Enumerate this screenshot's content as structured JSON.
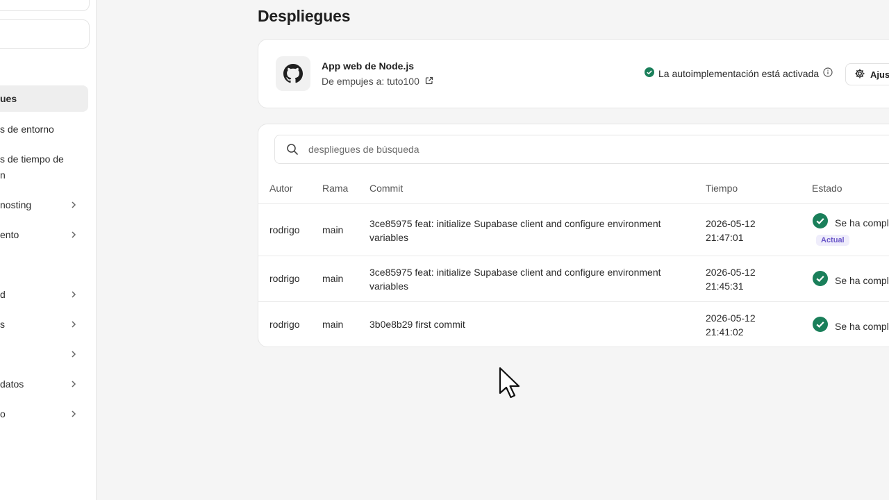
{
  "sidebar": {
    "items": [
      {
        "label": "ues",
        "active": true,
        "chevron": false
      },
      {
        "label": "s de entorno",
        "chevron": false
      },
      {
        "label": "s de tiempo de",
        "label2": "n",
        "chevron": false
      },
      {
        "label": "nosting",
        "chevron": true
      },
      {
        "label": "ento",
        "chevron": true
      },
      {
        "label": "d",
        "chevron": true
      },
      {
        "label": "s",
        "chevron": true
      },
      {
        "label": "",
        "chevron": true
      },
      {
        "label": " datos",
        "chevron": true
      },
      {
        "label": "o",
        "chevron": true
      }
    ]
  },
  "page": {
    "title": "Despliegues"
  },
  "repo": {
    "name": "App web de Node.js",
    "branch_text": "De empujes a: tuto100",
    "icon": "github-icon"
  },
  "auto_deploy": {
    "text": "La autoimplementación está activada"
  },
  "settings": {
    "label": "Ajus"
  },
  "search": {
    "placeholder": "despliegues de búsqueda"
  },
  "table": {
    "headers": {
      "author": "Autor",
      "branch": "Rama",
      "commit": "Commit",
      "time": "Tiempo",
      "status": "Estado"
    },
    "rows": [
      {
        "author": "rodrigo",
        "branch": "main",
        "commit": "3ce85975 feat: initialize Supabase client and configure environment variables",
        "date": "2026-05-12",
        "time": "21:47:01",
        "status": "Se ha compl",
        "badge": "Actual"
      },
      {
        "author": "rodrigo",
        "branch": "main",
        "commit": "3ce85975 feat: initialize Supabase client and configure environment variables",
        "date": "2026-05-12",
        "time": "21:45:31",
        "status": "Se ha compl"
      },
      {
        "author": "rodrigo",
        "branch": "main",
        "commit": "3b0e8b29 first commit",
        "date": "2026-05-12",
        "time": "21:41:02",
        "status": "Se ha compl"
      }
    ]
  },
  "colors": {
    "success": "#1a7f5a",
    "badge_text": "#6b58c9",
    "badge_bg": "#efedfb"
  }
}
